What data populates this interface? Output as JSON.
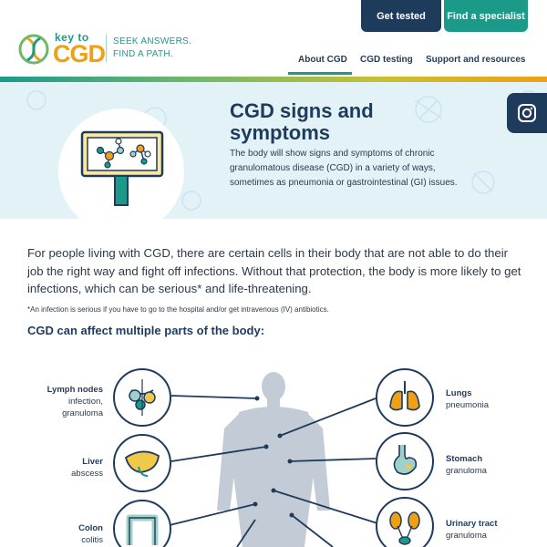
{
  "header": {
    "buttons": {
      "get_tested": "Get tested",
      "find_specialist": "Find a specialist"
    },
    "logo": {
      "key_to": "key to",
      "cgd": "CGD"
    },
    "tagline": {
      "line1": "SEEK ANSWERS.",
      "line2": "FIND A PATH."
    },
    "nav": {
      "about": "About CGD",
      "testing": "CGD testing",
      "support": "Support and resources"
    }
  },
  "hero": {
    "title_line1": "CGD signs and",
    "title_line2": "symptoms",
    "text": "The body will show signs and symptoms of chronic granulomatous disease (CGD) in a variety of ways, sometimes as pneumonia or gastrointestinal (GI) issues."
  },
  "main": {
    "intro": "For people living with CGD, there are certain cells in their body that are not able to do their job the right way and fight off infections. Without that protection, the body is more likely to get infections, which can be serious* and life-threatening.",
    "footnote": "*An infection is serious if you have to go to the hospital and/or get intravenous (IV) antibiotics.",
    "section_title": "CGD can affect multiple parts of the body:"
  },
  "body_parts": {
    "left": [
      {
        "name": "Lymph nodes",
        "desc1": "infection,",
        "desc2": "granuloma"
      },
      {
        "name": "Liver",
        "desc1": "abscess",
        "desc2": ""
      },
      {
        "name": "Colon",
        "desc1": "colitis",
        "desc2": ""
      }
    ],
    "right": [
      {
        "name": "Lungs",
        "desc1": "pneumonia",
        "desc2": ""
      },
      {
        "name": "Stomach",
        "desc1": "granuloma",
        "desc2": ""
      },
      {
        "name": "Urinary tract",
        "desc1": "granuloma",
        "desc2": ""
      }
    ]
  },
  "colors": {
    "navy": "#1f3b5c",
    "teal": "#1b9a8a",
    "orange": "#f0a015",
    "hero_bg": "#e3f2f7"
  }
}
